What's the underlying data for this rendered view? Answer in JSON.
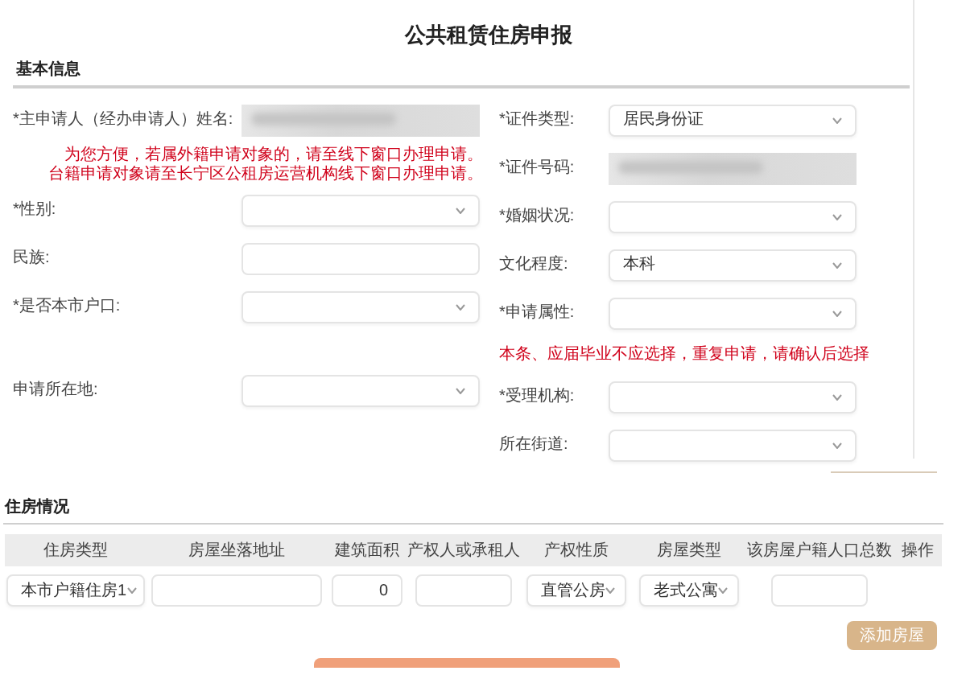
{
  "title": "公共租赁住房申报",
  "basic_info": {
    "heading": "基本信息",
    "left": [
      {
        "kind": "blurred",
        "label": "*主申请人（经办申请人）姓名:"
      },
      {
        "kind": "note",
        "lines": [
          "为您方便，若属外籍申请对象的，请至线下窗口办理申请。",
          "台籍申请对象请至长宁区公租房运营机构线下窗口办理申请。"
        ]
      },
      {
        "kind": "select",
        "label": "*性别:"
      },
      {
        "kind": "text",
        "label": "民族:"
      },
      {
        "kind": "select",
        "label": "*是否本市户口:"
      },
      {
        "kind": "gap"
      },
      {
        "kind": "select",
        "label": "申请所在地:"
      }
    ],
    "right": [
      {
        "kind": "select",
        "label": "*证件类型:",
        "value": "居民身份证"
      },
      {
        "kind": "blurred",
        "label": "*证件号码:"
      },
      {
        "kind": "select",
        "label": "*婚姻状况:"
      },
      {
        "kind": "select",
        "label": "文化程度:",
        "value": "本科"
      },
      {
        "kind": "select",
        "label": "*申请属性:"
      },
      {
        "kind": "note",
        "lines": [
          "本条、应届毕业不应选择，重复申请，请确认后选择"
        ]
      },
      {
        "kind": "select",
        "label": "*受理机构:"
      },
      {
        "kind": "select",
        "label": "所在街道:"
      }
    ]
  },
  "housing": {
    "heading": "住房情况",
    "columns": [
      "住房类型",
      "房屋坐落地址",
      "建筑面积",
      "产权人或承租人",
      "产权性质",
      "房屋类型",
      "该房屋户籍人口总数",
      "操作"
    ],
    "rows": [
      [
        {
          "kind": "select",
          "value": "本市户籍住房1"
        },
        {
          "kind": "text"
        },
        {
          "kind": "text",
          "value": "0"
        },
        {
          "kind": "text"
        },
        {
          "kind": "select",
          "value": "直管公房"
        },
        {
          "kind": "select",
          "value": "老式公寓"
        },
        {
          "kind": "text"
        }
      ]
    ],
    "add_button": "添加房屋"
  }
}
